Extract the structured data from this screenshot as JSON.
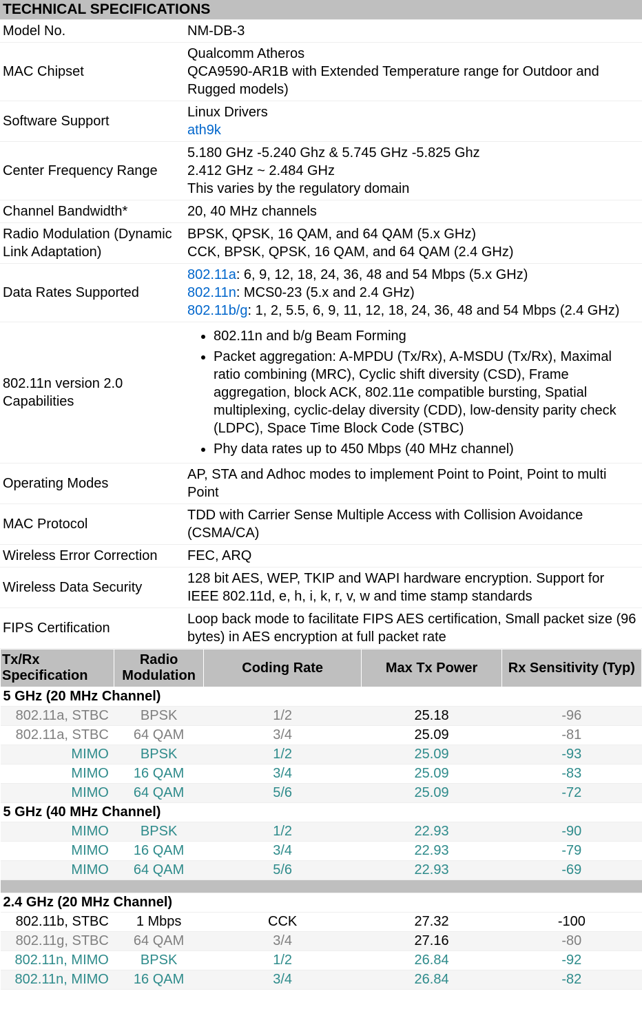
{
  "title": "TECHNICAL SPECIFICATIONS",
  "specs": {
    "model_no": {
      "label": "Model No.",
      "value": "NM-DB-3"
    },
    "mac_chipset": {
      "label": "MAC Chipset",
      "line1": "Qualcomm Atheros",
      "line2": "QCA9590-AR1B with Extended Temperature range for Outdoor and Rugged models)"
    },
    "software": {
      "label": "Software Support",
      "line1": "Linux Drivers",
      "link": "ath9k"
    },
    "center_freq": {
      "label": "Center Frequency Range",
      "line1": "5.180 GHz -5.240 Ghz & 5.745 GHz -5.825 Ghz",
      "line2": "2.412 GHz ~ 2.484 GHz",
      "line3": "This varies by the regulatory domain"
    },
    "channel_bw": {
      "label": "Channel Bandwidth*",
      "value": "20, 40 MHz channels"
    },
    "radio_mod": {
      "label": "Radio Modulation (Dynamic Link Adaptation)",
      "line1": "BPSK, QPSK, 16 QAM, and 64 QAM (5.x GHz)",
      "line2": "CCK, BPSK, QPSK, 16 QAM, and 64 QAM (2.4 GHz)"
    },
    "data_rates": {
      "label": "Data Rates Supported",
      "l1a": "802.11a",
      "l1b": ": 6, 9, 12, 18, 24, 36, 48 and 54 Mbps (5.x GHz)",
      "l2a": "802.11n",
      "l2b": ": MCS0-23 (5.x and 2.4 GHz)",
      "l3a": "802.11b/g",
      "l3b": ": 1, 2, 5.5, 6, 9, 11, 12, 18, 24, 36, 48 and 54 Mbps (2.4 GHz)"
    },
    "caps": {
      "label": "802.11n version 2.0 Capabilities",
      "b1": "802.11n and b/g Beam Forming",
      "b2": "Packet aggregation: A-MPDU (Tx/Rx), A-MSDU (Tx/Rx), Maximal ratio combining (MRC), Cyclic shift diversity (CSD), Frame aggregation, block ACK, 802.11e compatible bursting, Spatial multiplexing, cyclic-delay diversity (CDD), low-density parity check (LDPC), Space Time Block Code (STBC)",
      "b3": "Phy data rates up to 450 Mbps (40 MHz channel)"
    },
    "op_modes": {
      "label": "Operating Modes",
      "value": "AP, STA and Adhoc modes to implement Point to Point, Point to multi Point"
    },
    "mac_proto": {
      "label": "MAC Protocol",
      "value": "TDD with Carrier Sense Multiple Access with Collision Avoidance (CSMA/CA)"
    },
    "error_corr": {
      "label": "Wireless Error Correction",
      "value": "FEC, ARQ"
    },
    "security": {
      "label": "Wireless Data Security",
      "value": "128 bit AES, WEP, TKIP and WAPI hardware encryption. Support for IEEE 802.11d, e, h, i, k, r, v, w and time stamp standards"
    },
    "fips": {
      "label": "FIPS Certification",
      "value": "Loop back mode to facilitate FIPS AES certification, Small packet size (96 bytes) in AES encryption at full packet rate"
    }
  },
  "txrx": {
    "headers": {
      "spec": "Tx/Rx Specification",
      "mod": "Radio Modulation",
      "code": "Coding Rate",
      "pow": "Max Tx Power",
      "rx": "Rx Sensitivity (Typ)"
    },
    "groups": [
      {
        "title": "5 GHz (20 MHz Channel)",
        "rows": [
          {
            "spec": "802.11a, STBC",
            "mod": "BPSK",
            "code": "1/2",
            "pow": "25.18",
            "rx": "-96",
            "style": "gray",
            "zebra": true,
            "powBlack": true
          },
          {
            "spec": "802.11a, STBC",
            "mod": "64 QAM",
            "code": "3/4",
            "pow": "25.09",
            "rx": "-81",
            "style": "gray",
            "zebra": false,
            "powBlack": true
          },
          {
            "spec": "MIMO",
            "mod": "BPSK",
            "code": "1/2",
            "pow": "25.09",
            "rx": "-93",
            "style": "teal",
            "zebra": true
          },
          {
            "spec": "MIMO",
            "mod": "16 QAM",
            "code": "3/4",
            "pow": "25.09",
            "rx": "-83",
            "style": "teal",
            "zebra": false
          },
          {
            "spec": "MIMO",
            "mod": "64 QAM",
            "code": "5/6",
            "pow": "25.09",
            "rx": "-72",
            "style": "teal",
            "zebra": true
          }
        ]
      },
      {
        "title": "5 GHz (40 MHz Channel)",
        "rows": [
          {
            "spec": "MIMO",
            "mod": "BPSK",
            "code": "1/2",
            "pow": "22.93",
            "rx": "-90",
            "style": "teal",
            "zebra": true
          },
          {
            "spec": "MIMO",
            "mod": "16 QAM",
            "code": "3/4",
            "pow": "22.93",
            "rx": "-79",
            "style": "teal",
            "zebra": false
          },
          {
            "spec": "MIMO",
            "mod": "64 QAM",
            "code": "5/6",
            "pow": "22.93",
            "rx": "-69",
            "style": "teal",
            "zebra": true
          }
        ]
      },
      {
        "blank": true
      },
      {
        "title": "2.4 GHz (20 MHz Channel)",
        "rows": [
          {
            "spec": "802.11b, STBC",
            "mod": "1 Mbps",
            "code": "CCK",
            "pow": "27.32",
            "rx": "-100",
            "style": "black",
            "zebra": false
          },
          {
            "spec": "802.11g, STBC",
            "mod": "64 QAM",
            "code": "3/4",
            "pow": "27.16",
            "rx": "-80",
            "style": "gray",
            "zebra": true,
            "powBlack": true
          },
          {
            "spec": "802.11n, MIMO",
            "mod": "BPSK",
            "code": "1/2",
            "pow": "26.84",
            "rx": "-92",
            "style": "teal",
            "zebra": false
          },
          {
            "spec": "802.11n, MIMO",
            "mod": "16 QAM",
            "code": "3/4",
            "pow": "26.84",
            "rx": "-82",
            "style": "teal",
            "zebra": true
          }
        ]
      }
    ]
  }
}
